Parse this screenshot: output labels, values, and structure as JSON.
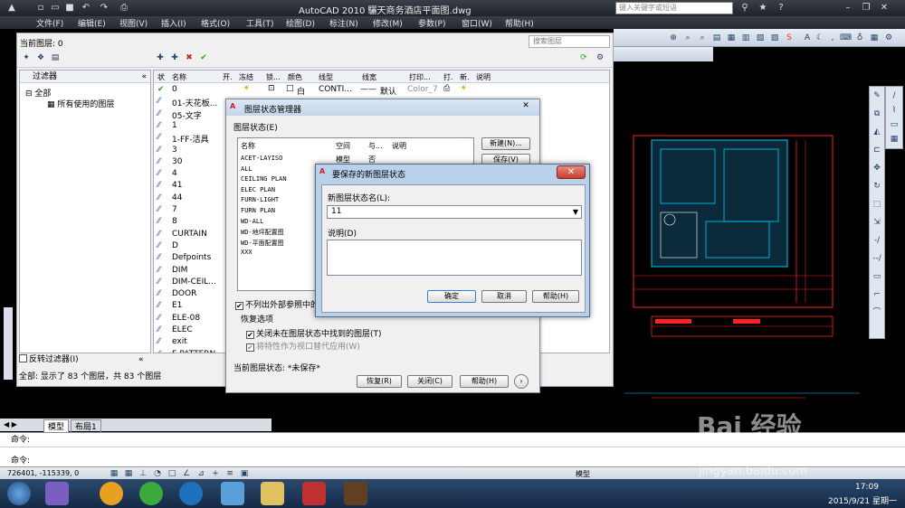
{
  "title_bar": {
    "title": "AutoCAD 2010    驪天商务酒店平面图.dwg",
    "search_placeholder": "键入关键字或短语"
  },
  "menu": {
    "items": [
      "文件(F)",
      "编辑(E)",
      "视图(V)",
      "插入(I)",
      "格式(O)",
      "工具(T)",
      "绘图(D)",
      "标注(N)",
      "修改(M)",
      "参数(P)",
      "窗口(W)",
      "帮助(H)"
    ]
  },
  "layer_manager": {
    "current_layer": "当前图层: 0",
    "search_placeholder": "搜索图层",
    "filters_label": "过滤器",
    "tree_all": "全部",
    "tree_used": "所有使用的图层",
    "invert_filter": "反转过滤器(I)",
    "columns": [
      "状",
      "名称",
      "开.",
      "冻结",
      "锁...",
      "颜色",
      "线型",
      "线宽",
      "打印...",
      "打.",
      "新.",
      "说明"
    ],
    "first_row": {
      "color_name": "白",
      "linetype": "CONTI...",
      "lineweight": "默认",
      "plot_style": "Color_7"
    },
    "layers": [
      "0",
      "01-天花板...",
      "05-文字",
      "1",
      "1-FF-洁具",
      "3",
      "30",
      "4",
      "41",
      "44",
      "7",
      "8",
      "CURTAIN",
      "D",
      "Defpoints",
      "DIM",
      "DIM-CEIL...",
      "DOOR",
      "E1",
      "ELE-08",
      "ELEC",
      "exit",
      "F-PATTERN"
    ],
    "status": "全部: 显示了 83 个图层，共 83 个图层"
  },
  "layer_states_manager": {
    "title": "图层状态管理器",
    "group_label": "图层状态(E)",
    "columns": [
      "名称",
      "空间",
      "与...",
      "说明"
    ],
    "first_row": {
      "space": "模型",
      "match": "否"
    },
    "states": [
      "ACET-LAYISO",
      "ALL",
      "CEILING PLAN",
      "ELEC PLAN",
      "FURN-LIGHT",
      "FURN PLAN",
      "WD-ALL",
      "WD-地坪配置图",
      "WD-平面配置图",
      "XXX"
    ],
    "new_button": "新建(N)...",
    "save_button": "保存(V)",
    "no_xref_checkbox": "不列出外部参照中的",
    "restore_options": "恢复选项",
    "off_not_found": "关闭未在图层状态中找到的图层(T)",
    "apply_as_override": "将特性作为视口替代应用(W)",
    "current_state": "当前图层状态: *未保存*",
    "restore_button": "恢复(R)",
    "close_button": "关闭(C)",
    "help_button": "帮助(H)"
  },
  "new_layer_state": {
    "title": "要保存的新图层状态",
    "name_label": "新图层状态名(L):",
    "name_value": "11",
    "desc_label": "说明(D)",
    "desc_value": "",
    "ok": "确定",
    "cancel": "取消",
    "help": "帮助(H)"
  },
  "tabs": [
    "模型",
    "布局1"
  ],
  "command": {
    "line1": "命令:",
    "line2": "命令:"
  },
  "status_bar": {
    "coords": "726401, -115339, 0",
    "model_label": "模型"
  },
  "taskbar": {
    "time": "17:09",
    "date": "2015/9/21 星期一"
  },
  "watermark": {
    "brand": "Bai 经验",
    "url": "jingyan.baidu.com"
  },
  "colors": {
    "title_bg": "#1e222a",
    "dialog_frame": "#b9d1ea",
    "close_red": "#c6402c",
    "canvas": "#000000",
    "cad_red": "#ff2020",
    "cad_cyan": "#00c8ff"
  }
}
